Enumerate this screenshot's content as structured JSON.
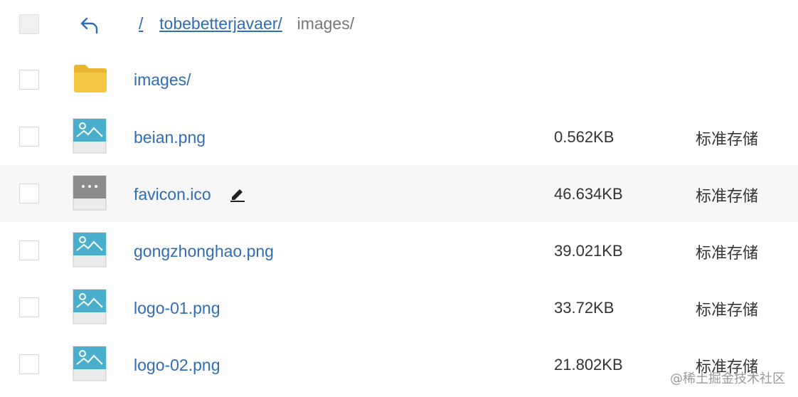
{
  "breadcrumb": {
    "root": "/",
    "bucket": "tobebetterjavaer/",
    "current": "images/"
  },
  "folder": {
    "name": "images/"
  },
  "files": [
    {
      "name": "beian.png",
      "size": "0.562KB",
      "storage": "标准存储",
      "icon": "image-file-icon"
    },
    {
      "name": "favicon.ico",
      "size": "46.634KB",
      "storage": "标准存储",
      "icon": "generic-file-icon"
    },
    {
      "name": "gongzhonghao.png",
      "size": "39.021KB",
      "storage": "标准存储",
      "icon": "image-file-icon"
    },
    {
      "name": "logo-01.png",
      "size": "33.72KB",
      "storage": "标准存储",
      "icon": "image-file-icon"
    },
    {
      "name": "logo-02.png",
      "size": "21.802KB",
      "storage": "标准存储",
      "icon": "image-file-icon"
    }
  ],
  "watermark": "@稀土掘金技术社区",
  "colors": {
    "link": "#2f6db5",
    "folder": "#f5c842",
    "image_icon": "#4aafcc",
    "generic_icon": "#8c8c8c",
    "hover_row": "#f7f7f7"
  }
}
